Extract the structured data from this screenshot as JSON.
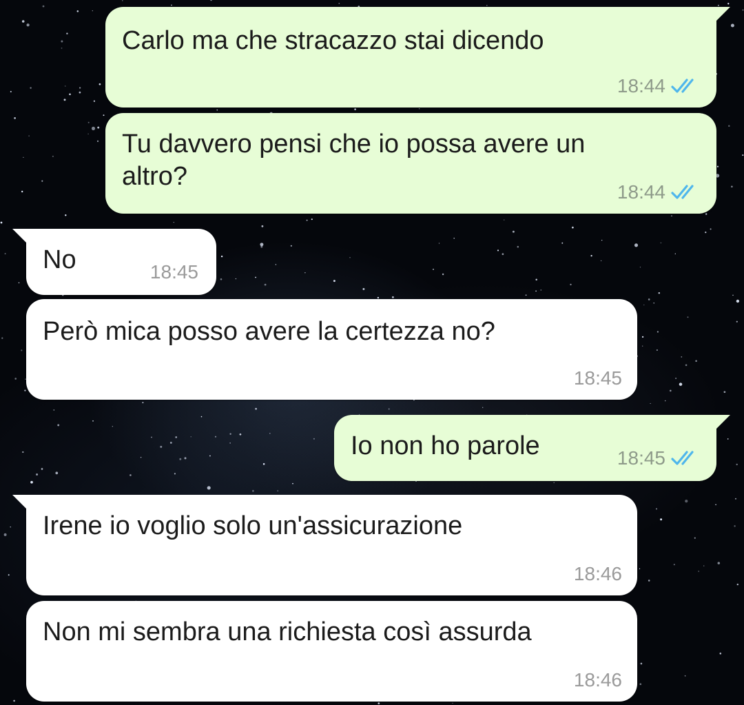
{
  "theme": {
    "outgoing_bubble": "#e7fdd6",
    "incoming_bubble": "#ffffff",
    "read_check_color": "#4fb6ec",
    "background": "starry night sky"
  },
  "messages": [
    {
      "direction": "outgoing",
      "text": "Carlo ma che stracazzo stai dicendo",
      "time": "18:44",
      "status": "read",
      "status_icon": "double-check-icon"
    },
    {
      "direction": "outgoing",
      "text": "Tu davvero pensi che io possa avere un\naltro?",
      "time": "18:44",
      "status": "read",
      "status_icon": "double-check-icon"
    },
    {
      "direction": "incoming",
      "text": "No",
      "time": "18:45"
    },
    {
      "direction": "incoming",
      "text": "Però mica posso avere la certezza no?",
      "time": "18:45"
    },
    {
      "direction": "outgoing",
      "text": "Io non ho parole",
      "time": "18:45",
      "status": "read",
      "status_icon": "double-check-icon"
    },
    {
      "direction": "incoming",
      "text": "Irene io voglio solo un'assicurazione",
      "time": "18:46"
    },
    {
      "direction": "incoming",
      "text": "Non mi sembra una richiesta così assurda",
      "time": "18:46"
    }
  ]
}
